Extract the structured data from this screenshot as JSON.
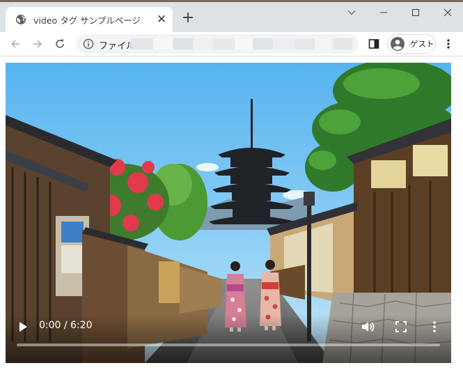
{
  "tab": {
    "title": "video タグ サンプルページ",
    "favicon": "globe-icon",
    "close_icon": "close-icon"
  },
  "new_tab": {
    "symbol": "+"
  },
  "window_controls": [
    "tab-search-icon",
    "minimize-icon",
    "maximize-icon",
    "close-icon"
  ],
  "toolbar": {
    "back_icon": "arrow-left-icon",
    "forward_icon": "arrow-right-icon",
    "reload_icon": "reload-icon",
    "omnibox": {
      "info_icon": "info-icon",
      "scheme_label": "ファイル",
      "url_obscured": true
    },
    "side_panel_icon": "side-panel-icon",
    "profile": {
      "label": "ゲスト",
      "icon": "person-icon"
    },
    "menu_icon": "kebab-menu-icon"
  },
  "video": {
    "time": "0:00 / 6:20",
    "progress": 0,
    "controls": [
      "play-icon",
      "volume-icon",
      "fullscreen-icon",
      "more-options-icon"
    ]
  }
}
